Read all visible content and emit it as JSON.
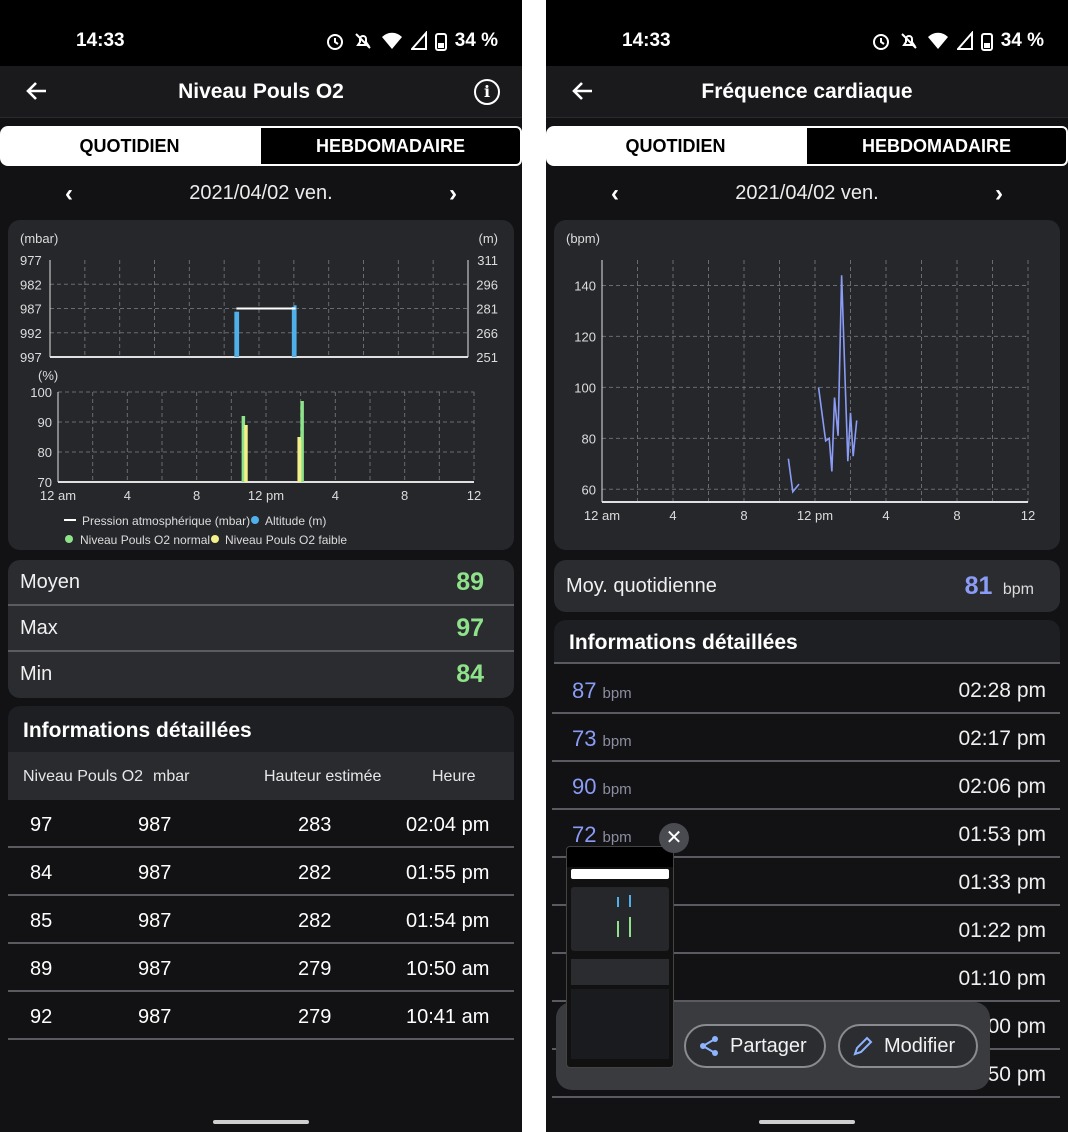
{
  "status": {
    "time": "14:33",
    "battery": "34 %"
  },
  "left": {
    "title": "Niveau Pouls O2",
    "tabs": [
      "QUOTIDIEN",
      "HEBDOMADAIRE"
    ],
    "date": "2021/04/02 ven.",
    "chart_data": [
      {
        "type": "bar",
        "ylabel": "(mbar)",
        "y2label": "(m)",
        "yticks": [
          "977",
          "982",
          "987",
          "992",
          "997"
        ],
        "y2ticks": [
          "311",
          "296",
          "281",
          "266",
          "251"
        ],
        "ylim": [
          997,
          977
        ],
        "y2lim": [
          251,
          311
        ],
        "xlim": [
          0,
          24
        ],
        "series": [
          {
            "name": "Pression atmosphérique (mbar)",
            "type": "line",
            "points": [
              [
                10.7,
                987
              ],
              [
                14.1,
                987
              ]
            ]
          },
          {
            "name": "Altitude (m)",
            "type": "bar",
            "x": [
              10.7,
              10.8,
              14.0,
              14.1
            ],
            "values": [
              279,
              279,
              282,
              283
            ]
          }
        ],
        "grid": true
      },
      {
        "type": "bar",
        "ylabel": "(%)",
        "yticks": [
          "100",
          "90",
          "80",
          "70"
        ],
        "ylim": [
          70,
          100
        ],
        "xticks": [
          "12 am",
          "4",
          "8",
          "12 pm",
          "4",
          "8",
          "12"
        ],
        "xlim": [
          0,
          24
        ],
        "series": [
          {
            "name": "Niveau Pouls O2 normal",
            "x": [
              10.68,
              14.07
            ],
            "values": [
              92,
              97
            ]
          },
          {
            "name": "Niveau Pouls O2 faible",
            "x": [
              10.83,
              13.9,
              13.92
            ],
            "values": [
              89,
              85,
              84
            ]
          }
        ],
        "grid": true,
        "legend": [
          "Pression atmosphérique (mbar)",
          "Altitude (m)",
          "Niveau Pouls O2 normal",
          "Niveau Pouls O2 faible"
        ]
      }
    ],
    "stats": [
      {
        "label": "Moyen",
        "value": "89"
      },
      {
        "label": "Max",
        "value": "97"
      },
      {
        "label": "Min",
        "value": "84"
      }
    ],
    "details_title": "Informations détaillées",
    "columns": [
      "Niveau Pouls O2",
      "mbar",
      "Hauteur estimée",
      "Heure"
    ],
    "rows": [
      [
        "97",
        "987",
        "283",
        "02:04 pm"
      ],
      [
        "84",
        "987",
        "282",
        "01:55 pm"
      ],
      [
        "85",
        "987",
        "282",
        "01:54 pm"
      ],
      [
        "89",
        "987",
        "279",
        "10:50 am"
      ],
      [
        "92",
        "987",
        "279",
        "10:41 am"
      ]
    ]
  },
  "right": {
    "title": "Fréquence cardiaque",
    "tabs": [
      "QUOTIDIEN",
      "HEBDOMADAIRE"
    ],
    "date": "2021/04/02 ven.",
    "chart_data": {
      "type": "line",
      "ylabel": "(bpm)",
      "yticks": [
        "140",
        "120",
        "100",
        "80",
        "60"
      ],
      "ylim": [
        55,
        150
      ],
      "xticks": [
        "12 am",
        "4",
        "8",
        "12 pm",
        "4",
        "8",
        "12"
      ],
      "xlim": [
        0,
        24
      ],
      "grid": true,
      "series": [
        {
          "name": "",
          "points": [
            [
              10.5,
              72
            ],
            [
              10.75,
              59
            ],
            [
              11.1,
              62
            ]
          ]
        },
        {
          "name": "",
          "points": [
            [
              12.2,
              100
            ],
            [
              12.6,
              79
            ],
            [
              12.8,
              80
            ],
            [
              12.95,
              67
            ],
            [
              13.1,
              96
            ],
            [
              13.3,
              81
            ],
            [
              13.5,
              144
            ],
            [
              13.7,
              102
            ],
            [
              13.85,
              71
            ],
            [
              14.0,
              90
            ],
            [
              14.15,
              73
            ],
            [
              14.35,
              87
            ]
          ]
        }
      ]
    },
    "avg_label": "Moy. quotidienne",
    "avg_value": "81",
    "avg_unit": "bpm",
    "details_title": "Informations détaillées",
    "unit": "bpm",
    "rows": [
      {
        "bpm": "87",
        "time": "02:28 pm"
      },
      {
        "bpm": "73",
        "time": "02:17 pm"
      },
      {
        "bpm": "90",
        "time": "02:06 pm"
      },
      {
        "bpm": "72",
        "time": "01:53 pm"
      },
      {
        "bpm": "",
        "time": "01:33 pm"
      },
      {
        "bpm": "",
        "time": "01:22 pm"
      },
      {
        "bpm": "",
        "time": "01:10 pm"
      },
      {
        "bpm": "",
        "time": "00 pm"
      },
      {
        "bpm": "",
        "time": "50 pm"
      }
    ],
    "share_label": "Partager",
    "edit_label": "Modifier"
  }
}
